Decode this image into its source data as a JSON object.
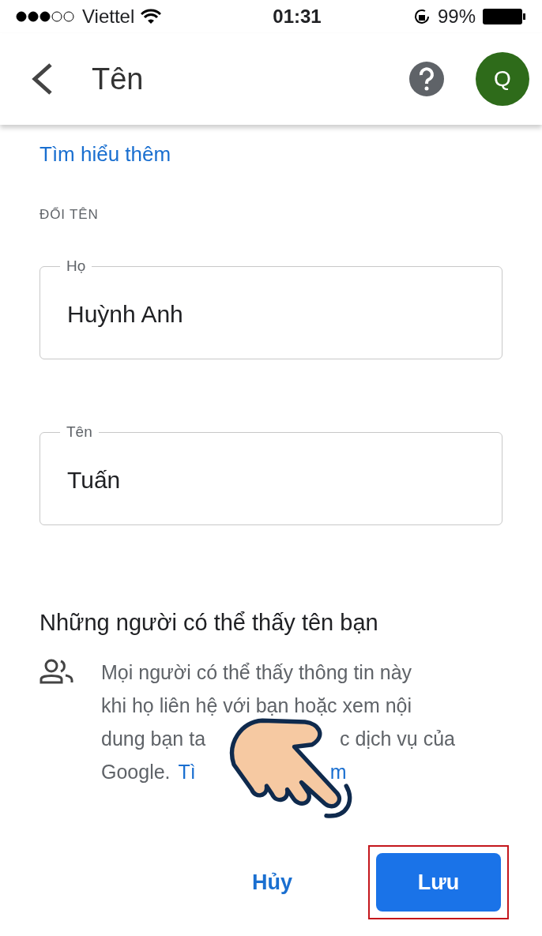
{
  "status_bar": {
    "carrier": "Viettel",
    "time": "01:31",
    "battery": "99%"
  },
  "header": {
    "title": "Tên",
    "avatar": "Q"
  },
  "learn_more": "Tìm hiểu thêm",
  "section_label": "ĐỔI TÊN",
  "fields": [
    {
      "label": "Họ",
      "value": "Huỳnh Anh"
    },
    {
      "label": "Tên",
      "value": "Tuấn"
    }
  ],
  "visibility": {
    "heading": "Những người có thể thấy tên bạn",
    "lines": [
      {
        "before": [
          {
            "kind": "text",
            "text": "Mọi người có thể thấy thông tin này"
          }
        ]
      },
      {
        "before": [
          {
            "kind": "text",
            "text": "khi họ liên hệ với bạn hoặc xem nội"
          }
        ]
      },
      {
        "before": [
          {
            "kind": "text",
            "text": "dung bạn ta"
          }
        ],
        "after": [
          {
            "kind": "text",
            "text": "c dịch vụ của"
          }
        ]
      },
      {
        "before": [
          {
            "kind": "text",
            "text": "Google."
          },
          {
            "kind": "link",
            "text": "Tì"
          }
        ],
        "after": [
          {
            "kind": "link",
            "text": "m"
          }
        ]
      }
    ]
  },
  "buttons": [
    {
      "kind": "text",
      "label": "Hủy",
      "highlighted": false
    },
    {
      "kind": "filled",
      "label": "Lưu",
      "highlighted": true
    }
  ]
}
